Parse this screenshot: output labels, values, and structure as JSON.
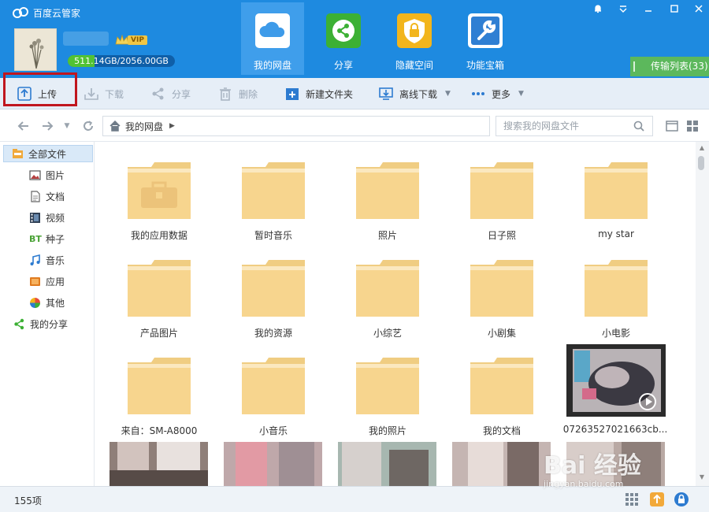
{
  "app": {
    "title": "百度云管家",
    "logo_icon": "baidu-cloud-logo-icon"
  },
  "user": {
    "vip_label": "VIP",
    "quota_text": "511.14GB/2056.00GB",
    "quota_fraction": 0.249
  },
  "nav": [
    {
      "label": "我的网盘",
      "icon": "cloud-icon",
      "color": "#ffffff",
      "active": true
    },
    {
      "label": "分享",
      "icon": "share-icon",
      "color": "#3cb034",
      "active": false
    },
    {
      "label": "隐藏空间",
      "icon": "lock-shield-icon",
      "color": "#f2b51c",
      "active": false
    },
    {
      "label": "功能宝箱",
      "icon": "wrench-icon",
      "color": "#2f7fd3",
      "active": false
    }
  ],
  "window_controls": [
    "notification-bell-icon",
    "menu-icon",
    "minimize-icon",
    "maximize-icon",
    "close-icon"
  ],
  "transfer_list": "传输列表(33)",
  "toolbar": {
    "upload": "上传",
    "download": "下载",
    "share": "分享",
    "delete": "删除",
    "new_folder": "新建文件夹",
    "offline_download": "离线下载",
    "more": "更多"
  },
  "address": {
    "path": "我的网盘",
    "search_placeholder": "搜索我的网盘文件"
  },
  "sidebar": {
    "items": [
      {
        "label": "全部文件",
        "icon": "folder-drive-icon"
      },
      {
        "label": "图片",
        "icon": "picture-icon"
      },
      {
        "label": "文档",
        "icon": "document-icon"
      },
      {
        "label": "视频",
        "icon": "video-icon"
      },
      {
        "label": "种子",
        "icon": "bt-icon"
      },
      {
        "label": "音乐",
        "icon": "music-note-icon"
      },
      {
        "label": "应用",
        "icon": "app-box-icon"
      },
      {
        "label": "其他",
        "icon": "other-pie-icon"
      },
      {
        "label": "我的分享",
        "icon": "share-icon"
      }
    ],
    "bt_text": "BT"
  },
  "files": [
    {
      "name": "我的应用数据",
      "type": "app-folder"
    },
    {
      "name": "暂时音乐",
      "type": "folder"
    },
    {
      "name": "照片",
      "type": "folder"
    },
    {
      "name": "日子照",
      "type": "folder"
    },
    {
      "name": "my star",
      "type": "folder"
    },
    {
      "name": "产品图片",
      "type": "folder"
    },
    {
      "name": "我的资源",
      "type": "folder"
    },
    {
      "name": "小综艺",
      "type": "folder"
    },
    {
      "name": "小剧集",
      "type": "folder"
    },
    {
      "name": "小电影",
      "type": "folder"
    },
    {
      "name": "来自：SM-A8000",
      "type": "folder"
    },
    {
      "name": "小音乐",
      "type": "folder"
    },
    {
      "name": "我的照片",
      "type": "folder"
    },
    {
      "name": "我的文档",
      "type": "folder"
    },
    {
      "name": "07263527021663cb...",
      "type": "video"
    }
  ],
  "status": {
    "count": "155项"
  },
  "watermark": {
    "text": "Bai 经验",
    "url": "jingyan.baidu.com"
  },
  "colors": {
    "header": "#1e8ae0",
    "folder": "#f7d58e",
    "highlight": "#c0161e"
  }
}
